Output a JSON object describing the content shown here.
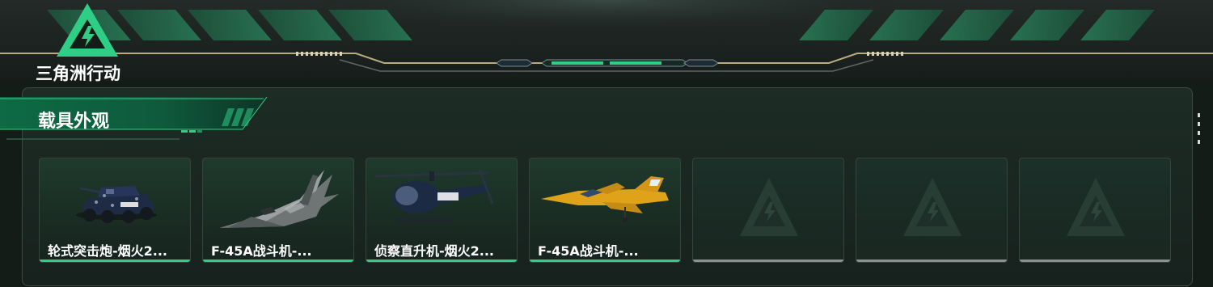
{
  "brand": {
    "name": "三角洲行动",
    "logo_icon": "lightning-triangle-icon"
  },
  "section": {
    "title": "载具外观"
  },
  "colors": {
    "accent": "#2fce86",
    "panel_border": "#3f4944",
    "empty_bar": "#8b918e"
  },
  "vehicles": [
    {
      "name": "轮式突击炮-烟火2...",
      "type": "wheeled-assault-gun",
      "scheme": "navy-camo"
    },
    {
      "name": "F-45A战斗机-...",
      "type": "fighter-jet",
      "scheme": "grey-camo"
    },
    {
      "name": "侦察直升机-烟火2...",
      "type": "scout-helicopter",
      "scheme": "navy"
    },
    {
      "name": "F-45A战斗机-...",
      "type": "fighter-jet",
      "scheme": "yellow"
    }
  ],
  "empty_slots": 3
}
